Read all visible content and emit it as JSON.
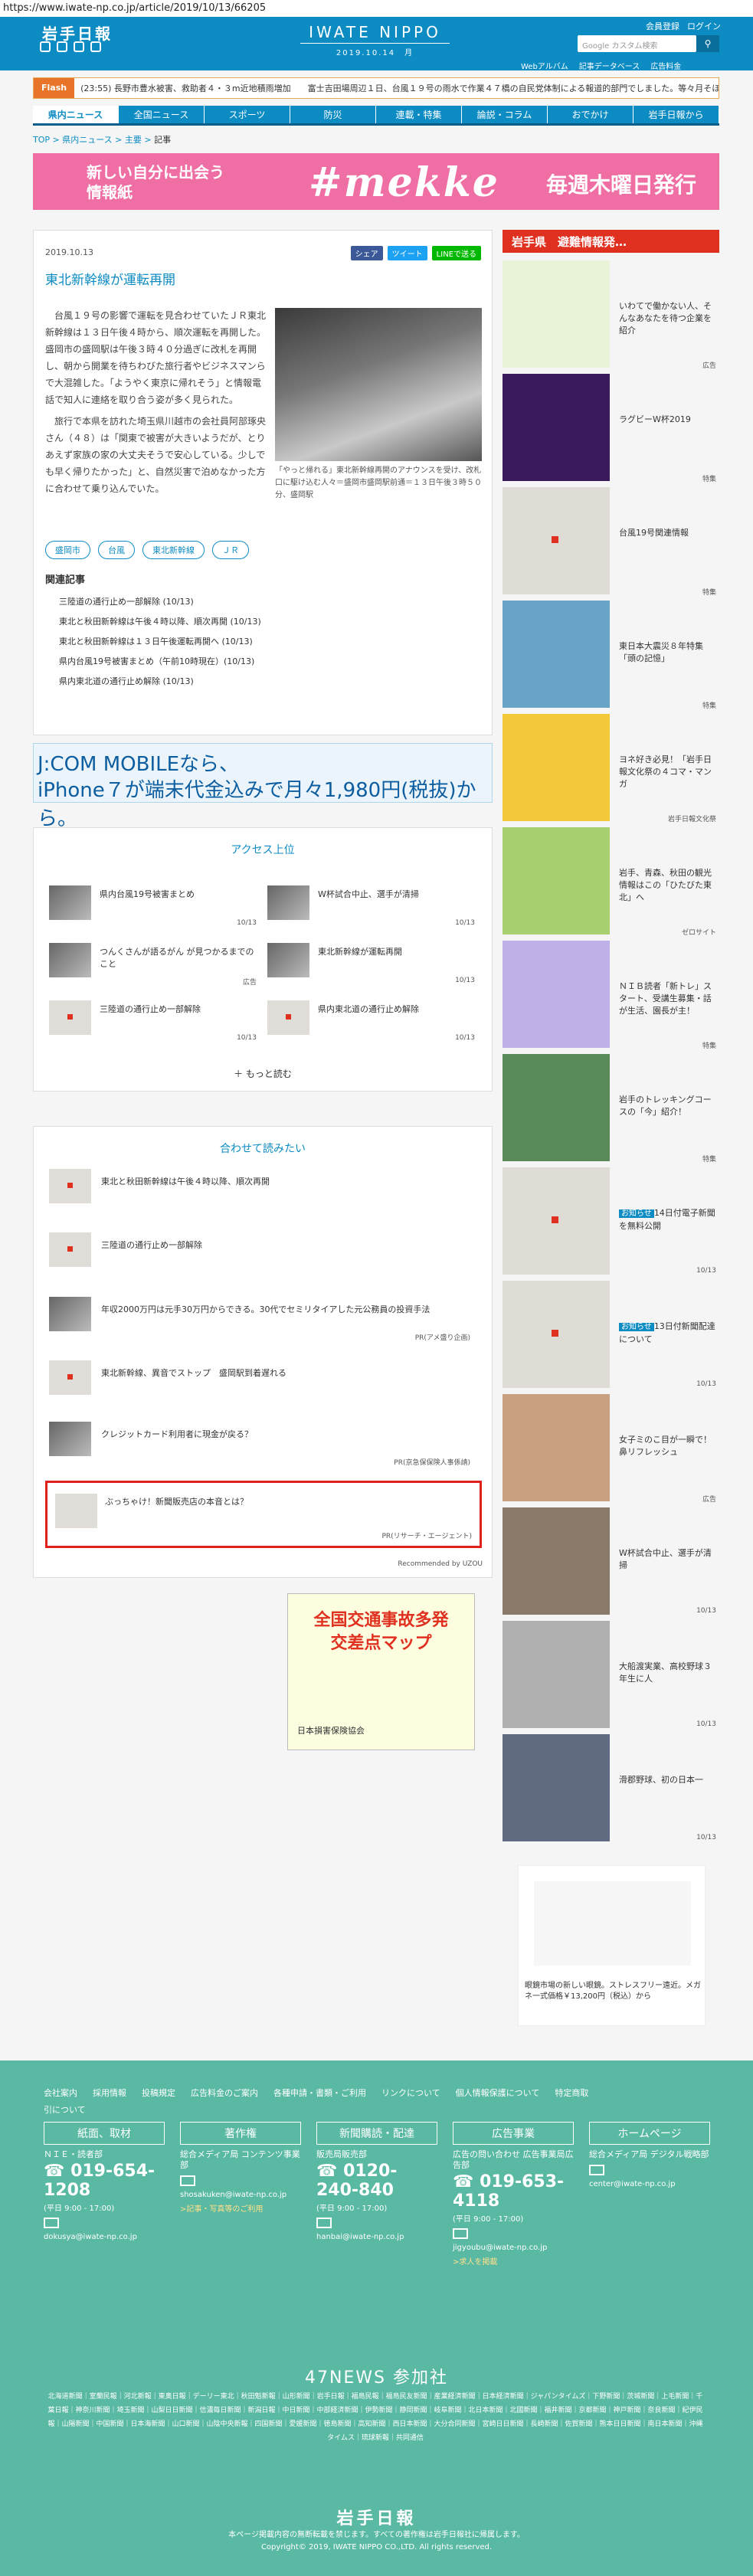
{
  "url": "https://www.iwate-np.co.jp/article/2019/10/13/66205",
  "header": {
    "logo": "岩手日報",
    "masthead": "IWATE NIPPO",
    "date": "2019.10.14　月",
    "links": [
      "会員登録",
      "ログイン"
    ],
    "sub": [
      "Webアルバム",
      "記事データベース",
      "広告料金"
    ],
    "search_placeholder": "Google カスタム検索"
  },
  "flash": {
    "label": "Flash",
    "text": "(23:55) 長野市豊水被害、救助者４・３m近地積雨増加　　富士吉田場周辺１日、台風１９号の雨水で作業４７橋の自民党体制による報道的部門でしました。等々月そほど４・３"
  },
  "nav": [
    "県内ニュース",
    "全国ニュース",
    "スポーツ",
    "防災",
    "連載・特集",
    "論説・コラム",
    "おでかけ",
    "岩手日報から"
  ],
  "breadcrumb": [
    "TOP",
    "県内ニュース",
    "主要",
    "記事"
  ],
  "banner": {
    "line1": "新しい自分に出会う",
    "line1b": "情報紙",
    "brand": "#mekke",
    "ruby": "めっけ",
    "line2": "毎週木曜日発行"
  },
  "article": {
    "date": "2019.10.13",
    "share": [
      "シェア",
      "ツイート",
      "LINEで送る"
    ],
    "title": "東北新幹線が運転再開",
    "body": [
      "台風１９号の影響で運転を見合わせていたＪＲ東北新幹線は１３日午後４時から、順次運転を再開した。盛岡市の盛岡駅は午後３時４０分過ぎに改札を再開し、朝から開業を待ちわびた旅行者やビジネスマンらで大混雑した。「ようやく東京に帰れそう」と情報電話で知人に連絡を取り合う姿が多く見られた。",
      "旅行で本県を訪れた埼玉県川越市の会社員阿部琢央さん（４８）は「関東で被害が大きいようだが、とりあえず家族の家の大丈夫そうで安心している。少しでも早く帰りたかった」と、自然災害で泊めなかった方に合わせて乗り込んでいた。"
    ],
    "caption": "「やっと帰れる」東北新幹線再開のアナウンスを受け、改札口に駆け込む人々＝盛岡市盛岡駅前通＝１３日午後３時５０分、盛岡駅",
    "tags": [
      "盛岡市",
      "台風",
      "東北新幹線",
      "ＪＲ"
    ],
    "related_head": "関連記事",
    "related": [
      "三陸道の通行止め一部解除 (10/13)",
      "東北と秋田新幹線は午後４時以降、順次再開 (10/13)",
      "東北と秋田新幹線は１３日午後運転再開へ (10/13)",
      "県内台風19号被害まとめ（午前10時現在）(10/13)",
      "県内東北道の通行止め解除 (10/13)"
    ]
  },
  "ad_jcom": {
    "line1": "J:COM MOBILEなら、",
    "line2": "iPhone７が端末代金込みで月々1,980円(税抜)から。"
  },
  "access": {
    "title": "アクセス上位",
    "items": [
      {
        "t": "県内台風19号被害まとめ",
        "d": "10/13"
      },
      {
        "t": "W杯試合中止、選手が清掃",
        "d": "10/13"
      },
      {
        "t": "つんくさんが語るがん が見つかるまでのこと",
        "d": "広告"
      },
      {
        "t": "東北新幹線が運転再開",
        "d": "10/13"
      },
      {
        "t": "三陸道の通行止め一部解除",
        "d": "10/13"
      },
      {
        "t": "県内東北道の通行止め解除",
        "d": "10/13"
      }
    ],
    "more": "もっと読む"
  },
  "also": {
    "title": "合わせて読みたい",
    "items": [
      {
        "t": "東北と秋田新幹線は午後４時以降、順次再開",
        "pr": ""
      },
      {
        "t": "三陸道の通行止め一部解除",
        "pr": ""
      },
      {
        "t": "年収2000万円は元手30万円からできる。30代でセミリタイアした元公務員の投資手法",
        "pr": "PR(アメ盛り企画)"
      },
      {
        "t": "東北新幹線、異音でストップ　盛岡駅到着遅れる",
        "pr": ""
      },
      {
        "t": "クレジットカード利用者に現金が戻る？",
        "pr": "PR(京急保保険人事係請)"
      },
      {
        "t": "ぶっちゃけ！新聞販売店の本音とは？",
        "pr": "PR(リサーチ・エージェント)"
      }
    ],
    "recommended": "Recommended by UZOU"
  },
  "ad_jiko": {
    "t1": "全国交通事故多発",
    "t2": "交差点マップ",
    "org": "日本損害保険協会"
  },
  "sidebar": {
    "head": "岩手県　避難情報発…",
    "items": [
      {
        "t": "いわてで働かない人、そんなあなたを待つ企業を紹介",
        "m": "広告"
      },
      {
        "t": "ラグビーW杯2019",
        "m": "特集"
      },
      {
        "t": "台風19号関連情報",
        "m": "特集"
      },
      {
        "t": "東日本大震災８年特集「頭の記憶」",
        "m": "特集"
      },
      {
        "t": "ヨネ好き必見！「岩手日報文化祭の４コマ・マンガ",
        "m": "岩手日報文化祭"
      },
      {
        "t": "岩手、青森、秋田の観光情報はこの「ひたびた東北」へ",
        "m": "ゼロサイト"
      },
      {
        "t": "ＮＩＢ読者「新トレ」スタート、受講生募集・話が生活、園長が主！",
        "m": "特集"
      },
      {
        "t": "岩手のトレッキングコースの「今」紹介！",
        "m": "特集"
      },
      {
        "t": "14日付電子新聞を無料公開",
        "badge": "お知らせ",
        "m": "10/13"
      },
      {
        "t": "13日付新聞配達について",
        "badge": "お知らせ",
        "m": "10/13"
      },
      {
        "t": "女子ミのこ目が一瞬で！ 鼻リフレッシュ",
        "m": "広告"
      },
      {
        "t": "W杯試合中止、選手が清掃",
        "m": "10/13"
      },
      {
        "t": "大船渡実業、高校野球３年生に人",
        "m": "10/13"
      },
      {
        "t": "滑郡野球、初の日本一",
        "m": "10/13"
      }
    ]
  },
  "side_ad": {
    "text": "眼鏡市場の新しい眼鏡。ストレスフリー遠近。メガネ一式価格￥13,200円（税込）から",
    "brand": "眼鏡市場"
  },
  "footer": {
    "links": [
      "会社案内",
      "採用情報",
      "投稿規定",
      "広告料金のご案内",
      "各種申請・書類・ご利用",
      "リンクについて",
      "個人情報保護について",
      "特定商取引について"
    ],
    "cols": [
      {
        "h": "紙面、取材",
        "s": "ＮＩＥ・読者部",
        "tel": "019-654-1208",
        "hours": "(平日 9:00 - 17:00)",
        "mail": "dokusya@iwate-np.co.jp"
      },
      {
        "h": "著作権",
        "s": "総合メディア局 コンテンツ事業部",
        "tel": "",
        "hours": "",
        "mail": "shosakuken@iwate-np.co.jp",
        "extra": ">記事・写真等のご利用"
      },
      {
        "h": "新聞購読・配達",
        "s": "販売局販売部",
        "tel": "0120-240-840",
        "hours": "(平日 9:00 - 17:00)",
        "mail": "hanbai@iwate-np.co.jp"
      },
      {
        "h": "広告事業",
        "s": "広告の問い合わせ 広告事業局広告部",
        "tel": "019-653-4118",
        "hours": "(平日 9:00 - 17:00)",
        "mail": "jigyoubu@iwate-np.co.jp",
        "extra": ">求人を掲載"
      },
      {
        "h": "ホームページ",
        "s": "総合メディア局 デジタル戦略部",
        "tel": "",
        "hours": "",
        "mail": "center@iwate-np.co.jp"
      }
    ],
    "news47": "47NEWS 参加社",
    "papers": "北海道新聞｜室蘭民報｜河北新報｜東奥日報｜デーリー東北｜秋田魁新報｜山形新聞｜岩手日報｜福島民報｜福島民友新聞｜産業経済新聞｜日本経済新聞｜ジャパンタイムズ｜下野新聞｜茨城新聞｜上毛新聞｜千葉日報｜神奈川新聞｜埼玉新聞｜山梨日日新聞｜信濃毎日新聞｜新潟日報｜中日新聞｜中部経済新聞｜伊勢新聞｜静岡新聞｜岐阜新聞｜北日本新聞｜北國新聞｜福井新聞｜京都新聞｜神戸新聞｜奈良新聞｜紀伊民報｜山陽新聞｜中国新聞｜日本海新聞｜山口新聞｜山陰中央新報｜四国新聞｜愛媛新聞｜徳島新聞｜高知新聞｜西日本新聞｜大分合同新聞｜宮崎日日新聞｜長崎新聞｜佐賀新聞｜熊本日日新聞｜南日本新聞｜沖縄タイムス｜琉球新報｜共同通信",
    "logo": "岩手日報",
    "copy1": "本ページ掲載内容の無断転載を禁じます。すべての著作権は岩手日報社に帰属します。",
    "copy2": "Copyright© 2019, IWATE NIPPO CO.,LTD. All rights reserved."
  }
}
